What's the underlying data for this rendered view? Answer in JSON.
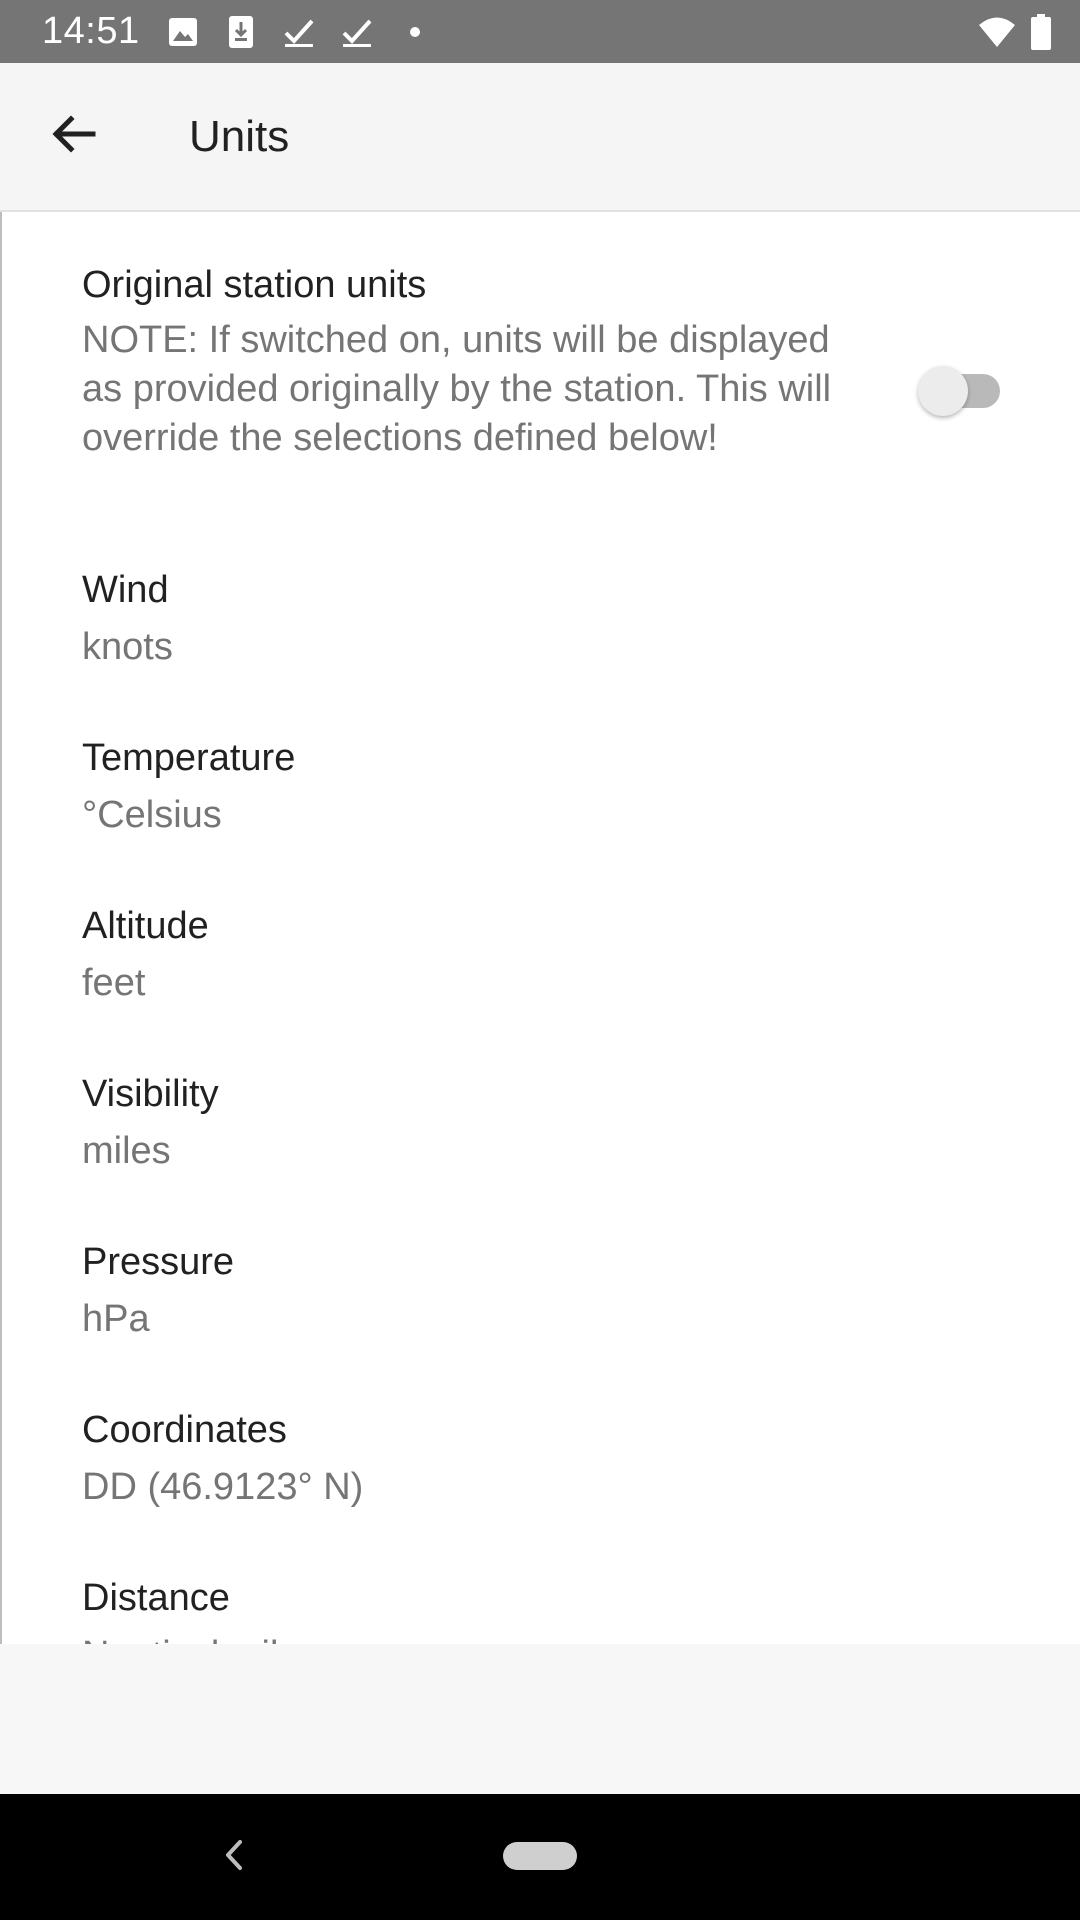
{
  "status_bar": {
    "time": "14:51",
    "left_icons": [
      "image-icon",
      "download-icon",
      "check-icon",
      "check-icon",
      "dot-icon"
    ],
    "right_icons": [
      "wifi-icon",
      "battery-icon"
    ]
  },
  "app_bar": {
    "title": "Units",
    "back_icon": "arrow-back-icon"
  },
  "preferences": {
    "original_units": {
      "title": "Original station units",
      "summary": "NOTE: If switched on, units will be displayed as provided originally by the station. This will override the selections defined below!",
      "enabled": false
    },
    "items": [
      {
        "title": "Wind",
        "value": "knots"
      },
      {
        "title": "Temperature",
        "value": "°Celsius"
      },
      {
        "title": "Altitude",
        "value": "feet"
      },
      {
        "title": "Visibility",
        "value": "miles"
      },
      {
        "title": "Pressure",
        "value": "hPa"
      },
      {
        "title": "Coordinates",
        "value": "DD (46.9123° N)"
      },
      {
        "title": "Distance",
        "value": "Nautical miles"
      }
    ]
  },
  "colors": {
    "status_bar": "#757575",
    "app_bar": "#f5f5f5",
    "primary_text": "#212121",
    "secondary_text": "#757575",
    "navigation_bar": "#000000"
  }
}
